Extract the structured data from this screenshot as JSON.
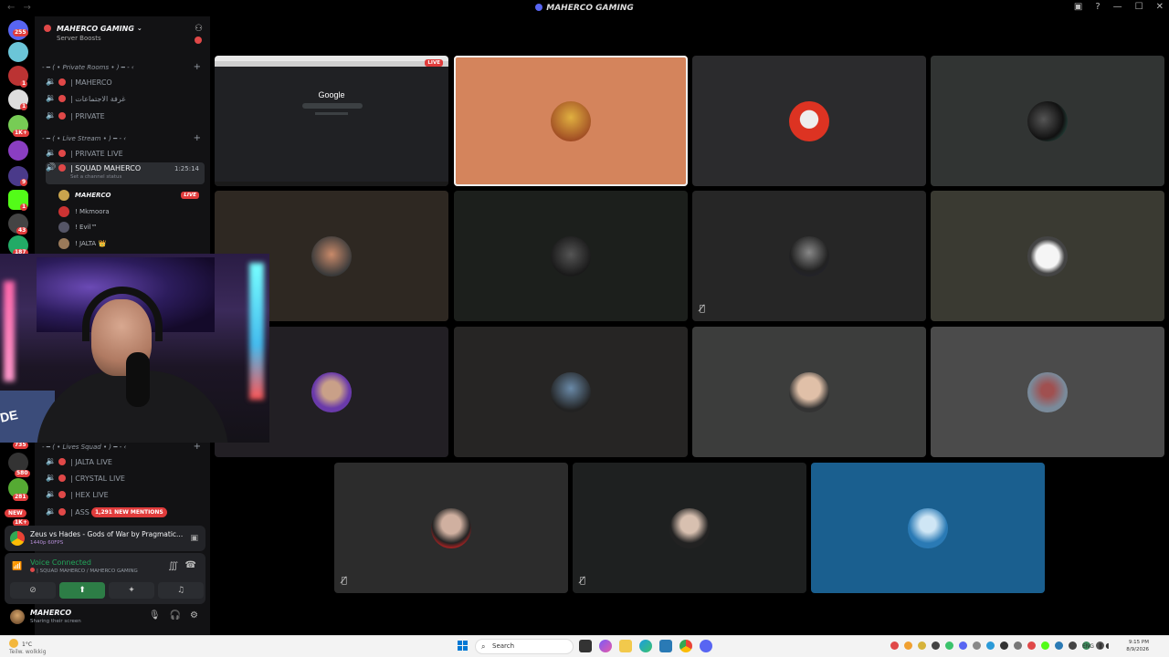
{
  "window": {
    "title": "MAHERCO GAMING",
    "nav": "← →"
  },
  "rail": {
    "badges": [
      "255",
      "1",
      "1",
      "1K+",
      "9",
      "1",
      "43",
      "187",
      "735",
      "580",
      "281",
      "1K+"
    ],
    "new_label": "NEW"
  },
  "guild": {
    "name": "MAHERCO GAMING",
    "boosts_label": "Server Boosts"
  },
  "categories": {
    "private_rooms": "- ━ ( • Private Rooms • ) ━ - ‹",
    "live_stream": "- ━ ( • Live Stream • ) ━ - ‹",
    "lives_squad": "- ━ ( • Lives Squad • ) ━ - ‹"
  },
  "channels": {
    "maherco": "| MAHERCO",
    "meetings": "| غرفة الاجتماعات",
    "private": "| PRIVATE",
    "private_live": "| PRIVATE LIVE",
    "squad": "| SQUAD MAHERCO",
    "squad_timer": "1:25:14",
    "squad_status": "Set a channel status",
    "jalta_live": "| JALTA LIVE",
    "crystal_live": "| CRYSTAL LIVE",
    "hex_live": "| HEX LIVE",
    "ass": "| ASS"
  },
  "members": {
    "me": "MAHERCO",
    "m2": "! Mkmoora",
    "m3": "! Evil™",
    "m4": "! JALTA 👑",
    "live_label": "LIVE"
  },
  "mentions": "1,291 NEW MENTIONS",
  "activity": {
    "title": "Zeus vs Hades - Gods of War by Pragmatic...",
    "sub": "1440p 60FPS"
  },
  "voice": {
    "status": "Voice Connected",
    "channel": "| SQUAD MAHERCO / MAHERCO GAMING"
  },
  "user": {
    "name": "MAHERCO",
    "status": "Sharing their screen"
  },
  "stage": {
    "screen_logo": "Google",
    "live_label": "LIVE"
  },
  "taskbar": {
    "temp": "1°C",
    "condition": "Teilw. wolkkig",
    "search_placeholder": "Search",
    "lang": "ENG",
    "time": "9:15 PM",
    "date": "8/9/2026"
  },
  "colors": {
    "live_red": "#e03c3c",
    "voice_green": "#23a55a",
    "tile_orange": "#d4845c",
    "tile_blue": "#1a5f8f"
  }
}
